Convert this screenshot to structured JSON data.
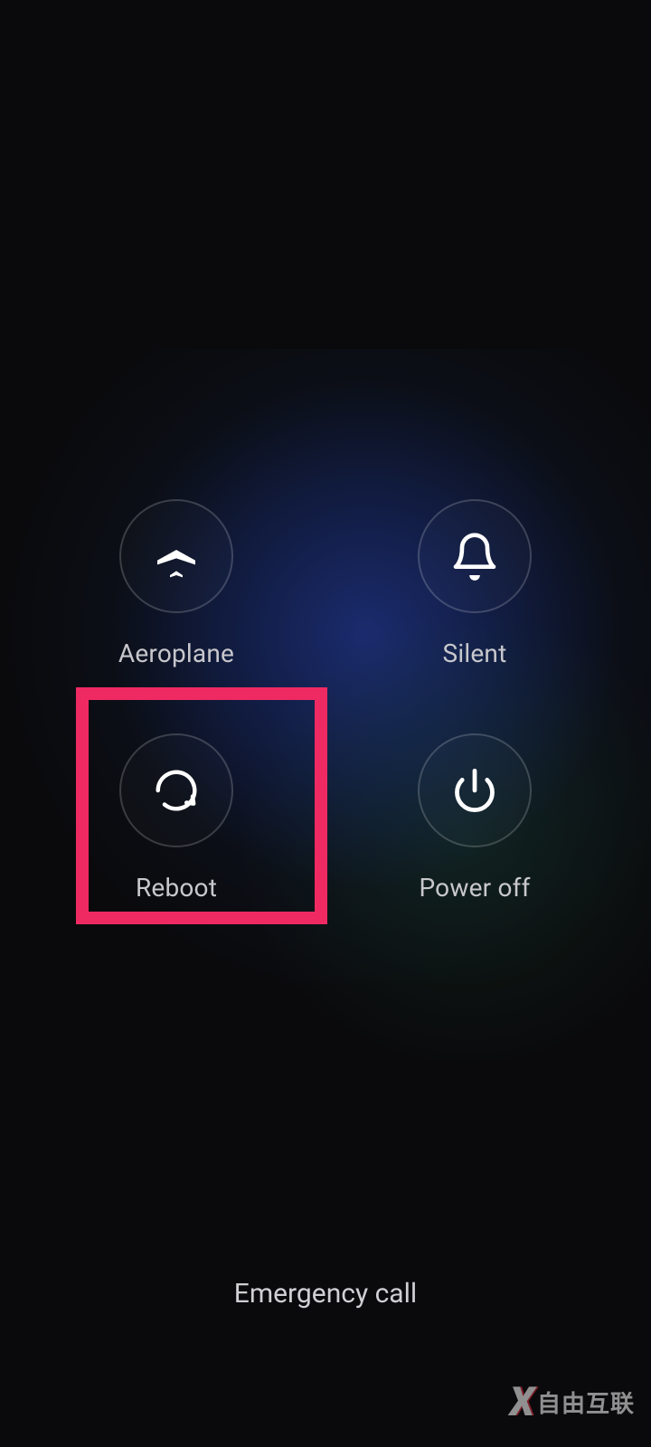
{
  "menu": {
    "aeroplane": {
      "label": "Aeroplane"
    },
    "silent": {
      "label": "Silent"
    },
    "reboot": {
      "label": "Reboot"
    },
    "poweroff": {
      "label": "Power off"
    }
  },
  "emergency_label": "Emergency call",
  "watermark": {
    "brand": "自由互联"
  },
  "highlight": {
    "target": "reboot",
    "color": "#ef2a63"
  }
}
